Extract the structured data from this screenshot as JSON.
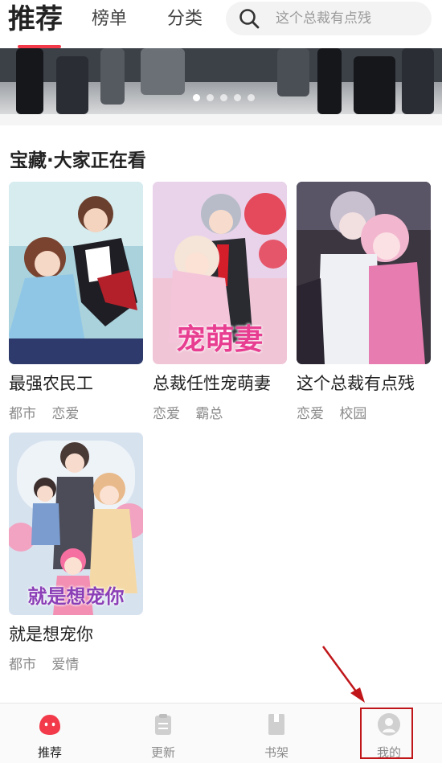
{
  "header": {
    "tabs": [
      {
        "label": "推荐"
      },
      {
        "label": "榜单"
      },
      {
        "label": "分类"
      }
    ],
    "search_placeholder": "这个总裁有点残"
  },
  "banner": {
    "dot_count": 5,
    "active_dot": 0
  },
  "section": {
    "title": "宝藏·大家正在看",
    "items": [
      {
        "title": "最强农民工",
        "tags": [
          "都市",
          "恋爱"
        ],
        "cover_text": ""
      },
      {
        "title": "总裁任性宠萌妻",
        "tags": [
          "恋爱",
          "霸总"
        ],
        "cover_text": "宠萌妻"
      },
      {
        "title": "这个总裁有点残",
        "tags": [
          "恋爱",
          "校园"
        ],
        "cover_text": ""
      },
      {
        "title": "就是想宠你",
        "tags": [
          "都市",
          "爱情"
        ],
        "cover_text": "就是想宠你"
      }
    ]
  },
  "bottom_nav": {
    "items": [
      {
        "label": "推荐",
        "icon": "recommend-icon",
        "active": true
      },
      {
        "label": "更新",
        "icon": "update-icon",
        "active": false
      },
      {
        "label": "书架",
        "icon": "bookshelf-icon",
        "active": false
      },
      {
        "label": "我的",
        "icon": "profile-icon",
        "active": false
      }
    ]
  },
  "colors": {
    "accent": "#f23a4a",
    "annotation": "#c0161a",
    "tag_text": "#8a8a8a"
  }
}
